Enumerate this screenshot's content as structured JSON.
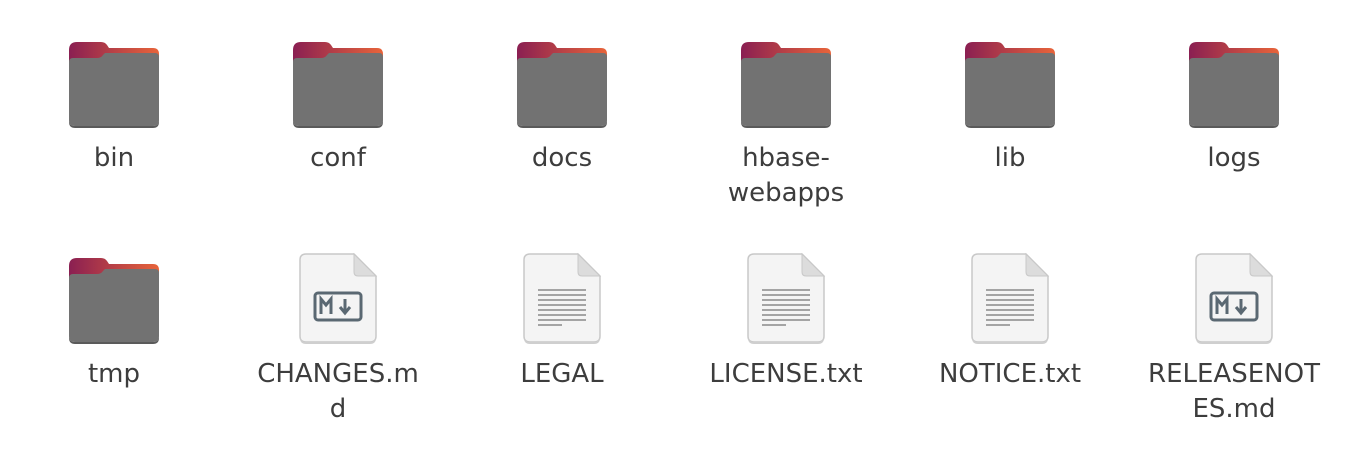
{
  "window": {
    "title": ""
  },
  "files": [
    {
      "name": "bin",
      "kind": "folder"
    },
    {
      "name": "conf",
      "kind": "folder"
    },
    {
      "name": "docs",
      "kind": "folder"
    },
    {
      "name": "hbase-webapps",
      "kind": "folder"
    },
    {
      "name": "lib",
      "kind": "folder"
    },
    {
      "name": "logs",
      "kind": "folder"
    },
    {
      "name": "tmp",
      "kind": "folder"
    },
    {
      "name": "CHANGES.md",
      "kind": "markdown"
    },
    {
      "name": "LEGAL",
      "kind": "text"
    },
    {
      "name": "LICENSE.txt",
      "kind": "text"
    },
    {
      "name": "NOTICE.txt",
      "kind": "text"
    },
    {
      "name": "RELEASENOTES.md",
      "kind": "markdown"
    }
  ],
  "icons": {
    "folder": "folder-icon",
    "markdown": "markdown-file-icon",
    "text": "text-file-icon"
  },
  "colors": {
    "folder_body": "#727272",
    "folder_tab_left": "#8a1f52",
    "folder_tab_right": "#e8643a",
    "label_text": "#3d3d3d"
  }
}
